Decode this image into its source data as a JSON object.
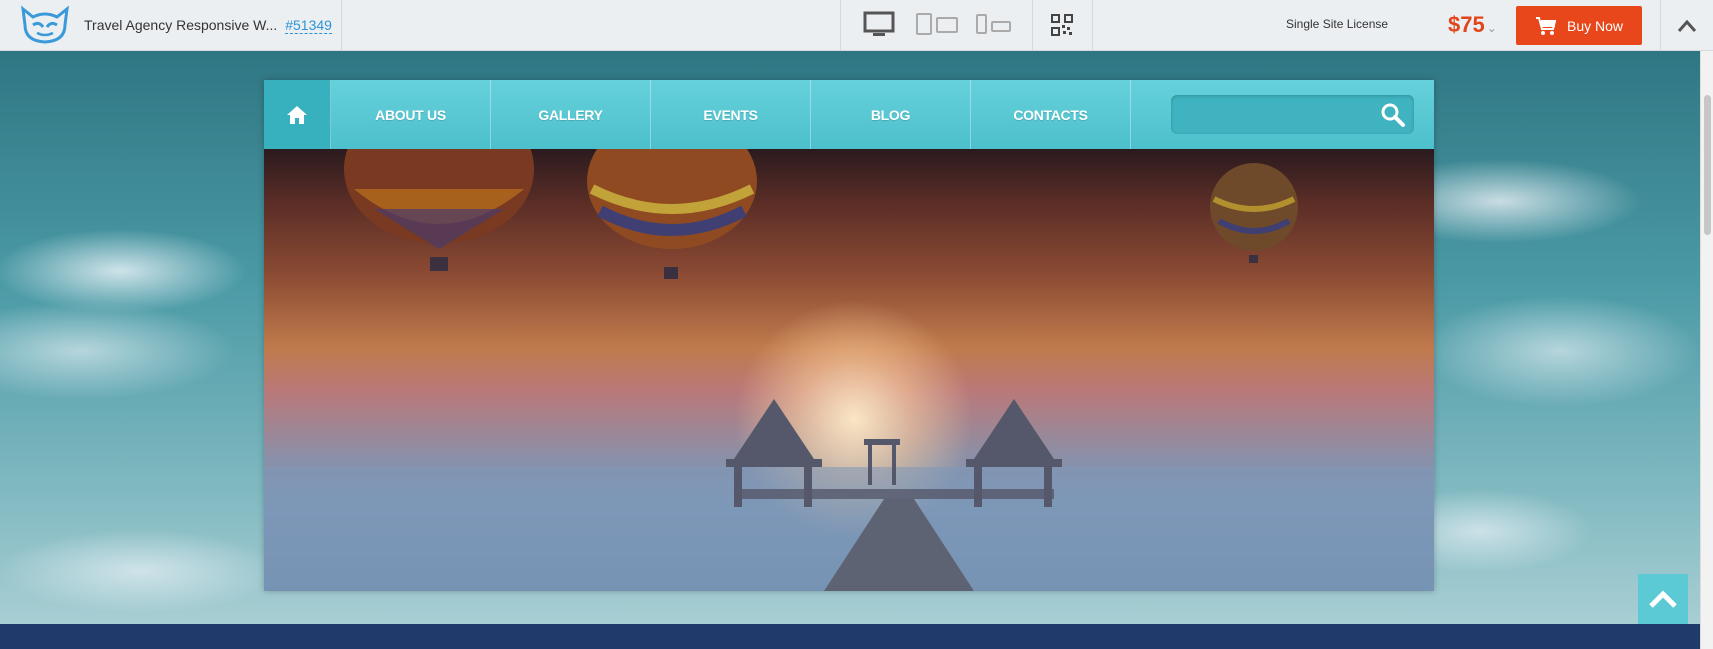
{
  "topbar": {
    "template_title": "Travel Agency Responsive W...",
    "template_id": "#51349",
    "license_label": "Single Site License",
    "price": "$75",
    "buy_label": "Buy Now"
  },
  "nav": {
    "items": [
      {
        "label": "ABOUT US"
      },
      {
        "label": "GALLERY"
      },
      {
        "label": "EVENTS"
      },
      {
        "label": "BLOG"
      },
      {
        "label": "CONTACTS"
      }
    ],
    "search_placeholder": ""
  },
  "colors": {
    "accent": "#4cc0cc",
    "buy": "#e8461b",
    "price": "#e1461a",
    "link": "#2c93d6"
  }
}
